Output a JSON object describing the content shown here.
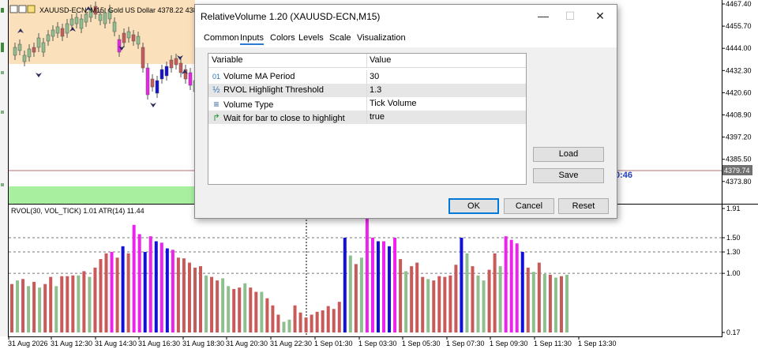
{
  "main_chart": {
    "symbol_label": "XAUUSD-ECN, M15:  Gold US Dollar  4378.22  4383.",
    "price_ticks": [
      "4467.40",
      "4455.70",
      "4444.00",
      "4432.30",
      "4420.60",
      "4408.90",
      "4397.20",
      "4385.50",
      "4373.80"
    ],
    "current_price": "4379.74",
    "clock_fragment": "0:46"
  },
  "indicator": {
    "label": "RVOL(30, VOL_TICK) 1.01 ATR(14) 11.44",
    "scale_ticks": [
      "1.91",
      "1.50",
      "1.30",
      "1.00",
      "0.17"
    ]
  },
  "time_axis": [
    "31 Aug 2026",
    "31 Aug 12:30",
    "31 Aug 14:30",
    "31 Aug 16:30",
    "31 Aug 18:30",
    "31 Aug 20:30",
    "31 Aug 22:30",
    "1 Sep 01:30",
    "1 Sep 03:30",
    "1 Sep 05:30",
    "1 Sep 07:30",
    "1 Sep 09:30",
    "1 Sep 11:30",
    "1 Sep 13:30"
  ],
  "rvol_bars": [
    {
      "v": 0.85,
      "c": "r"
    },
    {
      "v": 0.9,
      "c": "g"
    },
    {
      "v": 0.92,
      "c": "r"
    },
    {
      "v": 0.82,
      "c": "g"
    },
    {
      "v": 0.88,
      "c": "r"
    },
    {
      "v": 0.8,
      "c": "g"
    },
    {
      "v": 0.85,
      "c": "r"
    },
    {
      "v": 0.95,
      "c": "r"
    },
    {
      "v": 0.82,
      "c": "g"
    },
    {
      "v": 0.96,
      "c": "r"
    },
    {
      "v": 0.96,
      "c": "r"
    },
    {
      "v": 0.97,
      "c": "r"
    },
    {
      "v": 0.97,
      "c": "g"
    },
    {
      "v": 1.03,
      "c": "r"
    },
    {
      "v": 0.95,
      "c": "g"
    },
    {
      "v": 1.08,
      "c": "r"
    },
    {
      "v": 1.2,
      "c": "r"
    },
    {
      "v": 1.28,
      "c": "r"
    },
    {
      "v": 1.3,
      "c": "m"
    },
    {
      "v": 1.22,
      "c": "r"
    },
    {
      "v": 1.38,
      "c": "b"
    },
    {
      "v": 1.28,
      "c": "r"
    },
    {
      "v": 1.68,
      "c": "m"
    },
    {
      "v": 1.55,
      "c": "m"
    },
    {
      "v": 1.3,
      "c": "b"
    },
    {
      "v": 1.52,
      "c": "m"
    },
    {
      "v": 1.45,
      "c": "b"
    },
    {
      "v": 1.43,
      "c": "m"
    },
    {
      "v": 1.35,
      "c": "b"
    },
    {
      "v": 1.33,
      "c": "m"
    },
    {
      "v": 1.22,
      "c": "r"
    },
    {
      "v": 1.21,
      "c": "r"
    },
    {
      "v": 1.15,
      "c": "r"
    },
    {
      "v": 1.08,
      "c": "r"
    },
    {
      "v": 1.1,
      "c": "r"
    },
    {
      "v": 0.97,
      "c": "g"
    },
    {
      "v": 0.95,
      "c": "r"
    },
    {
      "v": 0.9,
      "c": "r"
    },
    {
      "v": 0.93,
      "c": "g"
    },
    {
      "v": 0.82,
      "c": "g"
    },
    {
      "v": 0.78,
      "c": "r"
    },
    {
      "v": 0.8,
      "c": "r"
    },
    {
      "v": 0.86,
      "c": "g"
    },
    {
      "v": 0.8,
      "c": "r"
    },
    {
      "v": 0.74,
      "c": "r"
    },
    {
      "v": 0.74,
      "c": "g"
    },
    {
      "v": 0.65,
      "c": "r"
    },
    {
      "v": 0.55,
      "c": "r"
    },
    {
      "v": 0.42,
      "c": "r"
    },
    {
      "v": 0.32,
      "c": "g"
    },
    {
      "v": 0.35,
      "c": "g"
    },
    {
      "v": 0.55,
      "c": "r"
    },
    {
      "v": 0.45,
      "c": "r"
    },
    {
      "v": 0.38,
      "c": "r"
    },
    {
      "v": 0.42,
      "c": "r"
    },
    {
      "v": 0.46,
      "c": "r"
    },
    {
      "v": 0.48,
      "c": "r"
    },
    {
      "v": 0.54,
      "c": "r"
    },
    {
      "v": 0.5,
      "c": "r"
    },
    {
      "v": 0.6,
      "c": "r"
    },
    {
      "v": 1.5,
      "c": "b"
    },
    {
      "v": 1.25,
      "c": "g"
    },
    {
      "v": 1.13,
      "c": "r"
    },
    {
      "v": 1.22,
      "c": "g"
    },
    {
      "v": 1.85,
      "c": "m"
    },
    {
      "v": 1.5,
      "c": "m"
    },
    {
      "v": 1.45,
      "c": "b"
    },
    {
      "v": 1.45,
      "c": "m"
    },
    {
      "v": 1.38,
      "c": "b"
    },
    {
      "v": 1.5,
      "c": "m"
    },
    {
      "v": 1.2,
      "c": "r"
    },
    {
      "v": 1.03,
      "c": "g"
    },
    {
      "v": 1.1,
      "c": "r"
    },
    {
      "v": 1.15,
      "c": "r"
    },
    {
      "v": 0.95,
      "c": "r"
    },
    {
      "v": 0.92,
      "c": "g"
    },
    {
      "v": 0.9,
      "c": "r"
    },
    {
      "v": 0.96,
      "c": "r"
    },
    {
      "v": 0.95,
      "c": "r"
    },
    {
      "v": 0.97,
      "c": "r"
    },
    {
      "v": 1.12,
      "c": "r"
    },
    {
      "v": 1.5,
      "c": "b"
    },
    {
      "v": 1.28,
      "c": "g"
    },
    {
      "v": 1.1,
      "c": "r"
    },
    {
      "v": 0.97,
      "c": "g"
    },
    {
      "v": 0.9,
      "c": "g"
    },
    {
      "v": 1.05,
      "c": "r"
    },
    {
      "v": 1.28,
      "c": "r"
    },
    {
      "v": 1.1,
      "c": "g"
    },
    {
      "v": 1.52,
      "c": "m"
    },
    {
      "v": 1.47,
      "c": "m"
    },
    {
      "v": 1.42,
      "c": "m"
    },
    {
      "v": 1.3,
      "c": "b"
    },
    {
      "v": 1.08,
      "c": "r"
    },
    {
      "v": 1.02,
      "c": "g"
    },
    {
      "v": 1.15,
      "c": "r"
    },
    {
      "v": 0.99,
      "c": "g"
    },
    {
      "v": 0.98,
      "c": "r"
    },
    {
      "v": 0.94,
      "c": "g"
    },
    {
      "v": 0.96,
      "c": "r"
    },
    {
      "v": 0.98,
      "c": "g"
    }
  ],
  "colors": {
    "red": "#c85a5a",
    "green": "#8fbf8f",
    "magenta": "#ee22ee",
    "blue": "#1010d8",
    "session_band": "#fbe1bb",
    "green_band": "#a8f0a0",
    "price_label_bg": "#707070"
  },
  "dialog": {
    "title": "RelativeVolume 1.20 (XAUUSD-ECN,M15)",
    "tabs": [
      "Common",
      "Inputs",
      "Colors",
      "Levels",
      "Scale",
      "Visualization"
    ],
    "columns": {
      "variable": "Variable",
      "value": "Value"
    },
    "params": [
      {
        "icon": "01",
        "name": "Volume MA Period",
        "value": "30"
      },
      {
        "icon": "½",
        "name": "RVOL Highlight Threshold",
        "value": "1.3"
      },
      {
        "icon": "≡",
        "name": "Volume Type",
        "value": "Tick Volume"
      },
      {
        "icon": "↱",
        "name": "Wait for bar to close to highlight",
        "value": "true"
      }
    ],
    "load_label": "Load",
    "save_label": "Save",
    "ok_label": "OK",
    "cancel_label": "Cancel",
    "reset_label": "Reset"
  }
}
